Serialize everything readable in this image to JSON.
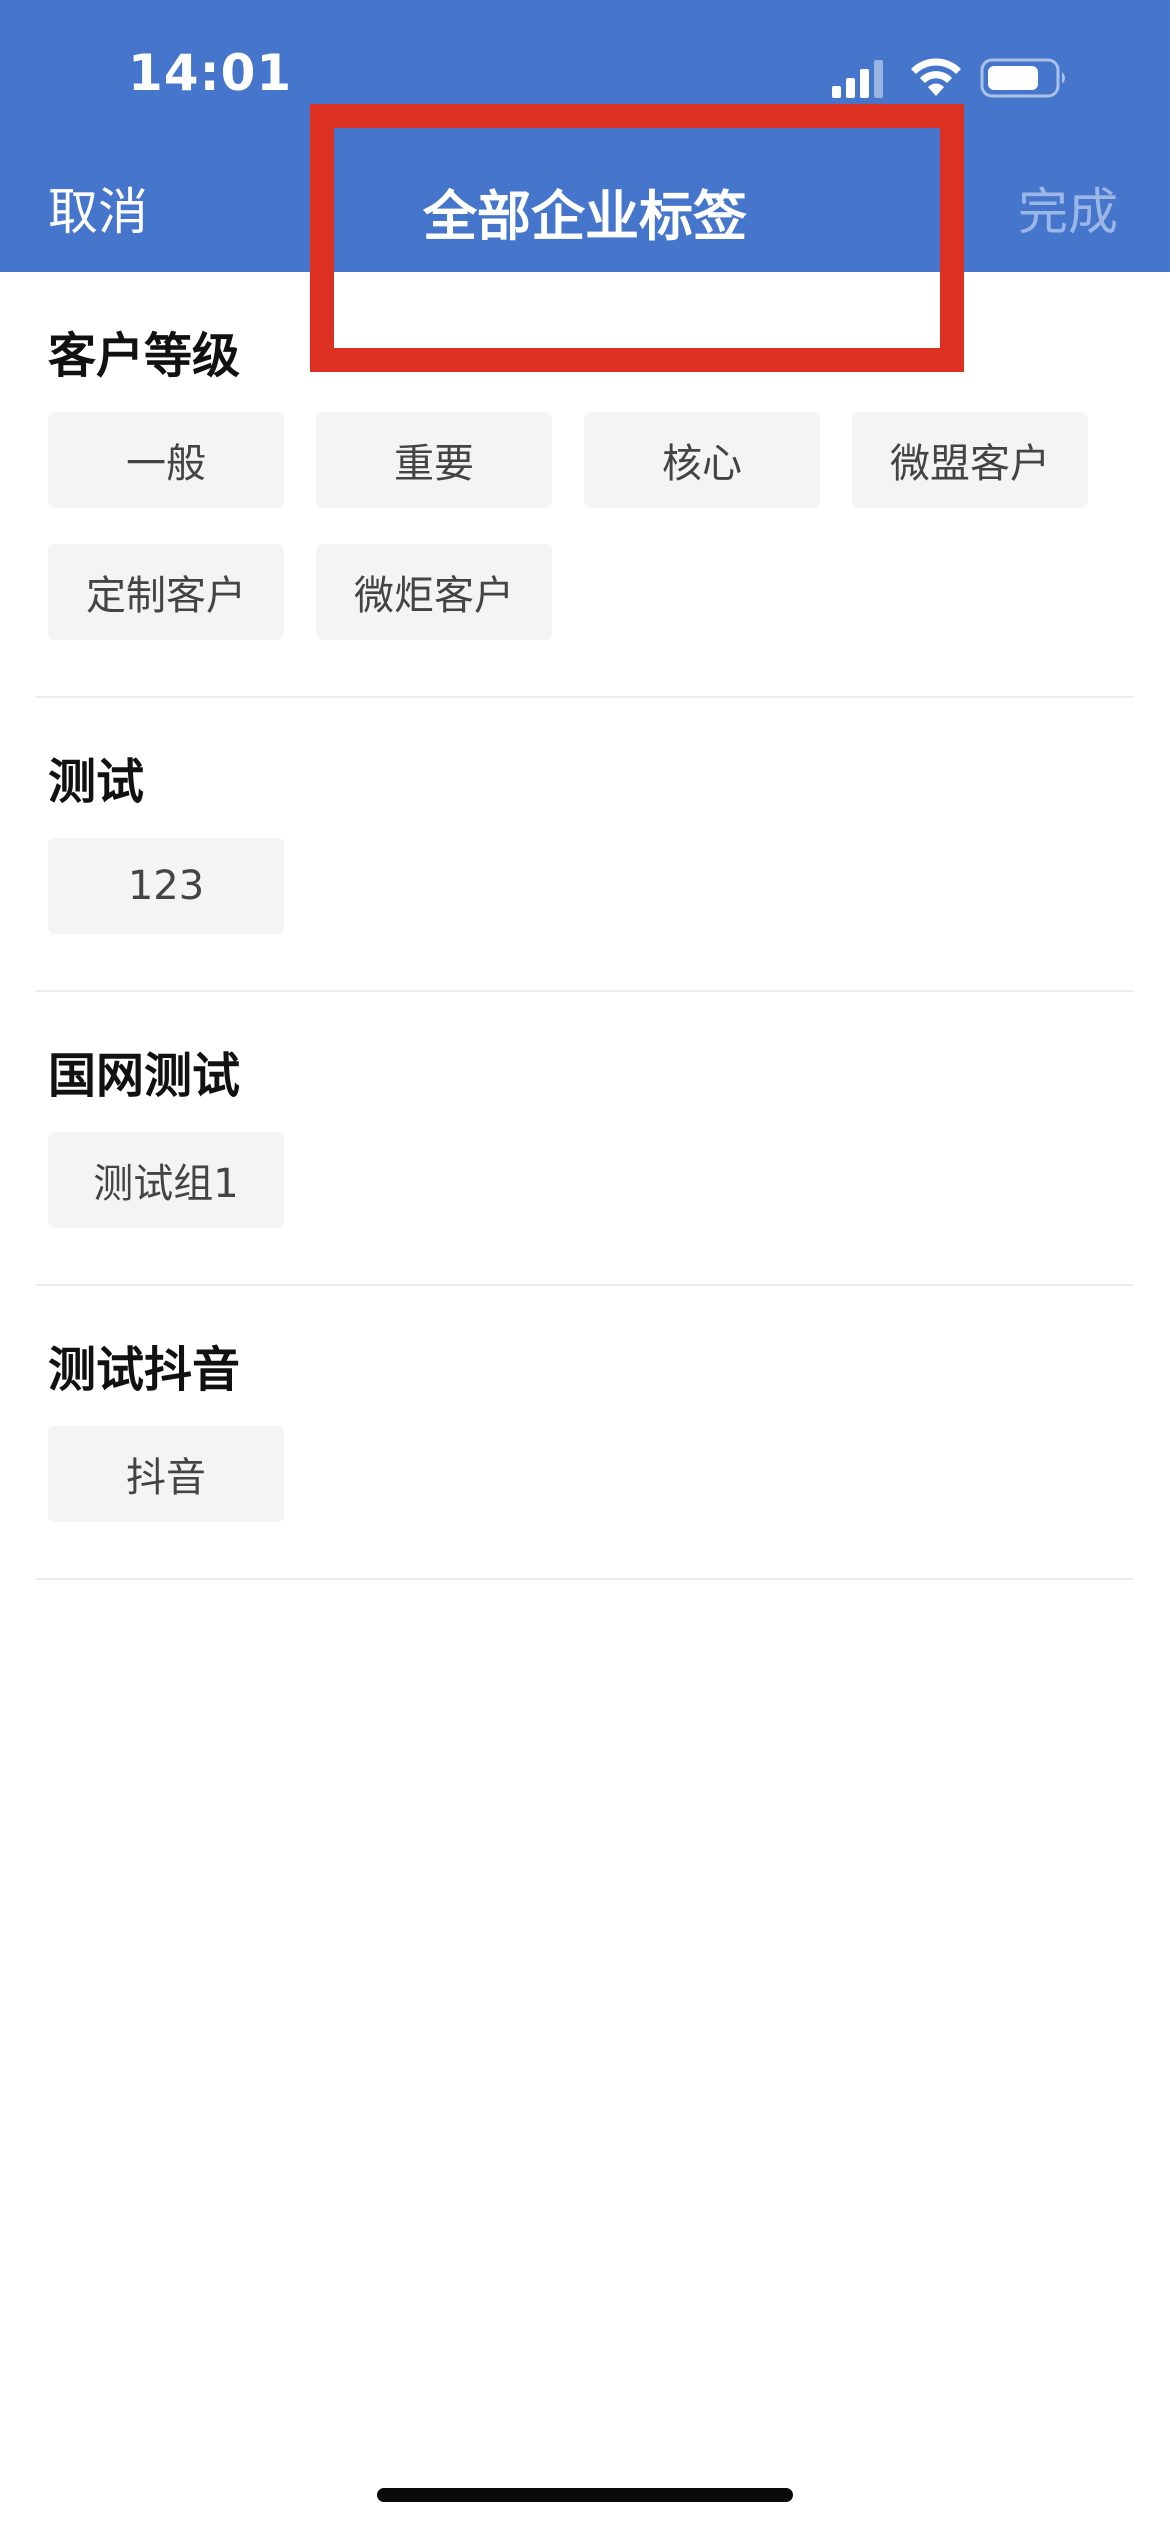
{
  "status_bar": {
    "time": "14:01",
    "icons": [
      "signal-icon",
      "wifi-icon",
      "battery-icon"
    ]
  },
  "nav": {
    "cancel_label": "取消",
    "title": "全部企业标签",
    "done_label": "完成"
  },
  "colors": {
    "header_bg": "#4676cb",
    "done_disabled": "#9cb6e6",
    "highlight": "#dc3022",
    "chip_bg": "#f4f4f4"
  },
  "groups": [
    {
      "title": "客户等级",
      "tags": [
        "一般",
        "重要",
        "核心",
        "微盟客户",
        "定制客户",
        "微炬客户"
      ]
    },
    {
      "title": "测试",
      "tags": [
        "123"
      ]
    },
    {
      "title": "国网测试",
      "tags": [
        "测试组1"
      ]
    },
    {
      "title": "测试抖音",
      "tags": [
        "抖音"
      ]
    }
  ]
}
